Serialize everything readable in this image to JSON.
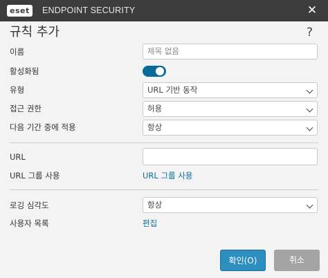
{
  "titlebar": {
    "logo_text": "eset",
    "app_title": "ENDPOINT SECURITY",
    "close_glyph": "✕"
  },
  "dialog": {
    "title": "규칙 추가",
    "help_glyph": "?"
  },
  "form": {
    "name": {
      "label": "이름",
      "placeholder": "제목 없음"
    },
    "enabled": {
      "label": "활성화됨",
      "value": true
    },
    "type": {
      "label": "유형",
      "value": "URL 기반 동작"
    },
    "access": {
      "label": "접근 권한",
      "value": "허용"
    },
    "apply_period": {
      "label": "다음 기간 중에 적용",
      "value": "항상"
    },
    "url": {
      "label": "URL",
      "value": ""
    },
    "url_group": {
      "label": "URL 그룹 사용",
      "link": "URL 그룹 사용"
    },
    "log_severity": {
      "label": "로깅 심각도",
      "value": "항상"
    },
    "user_list": {
      "label": "사용자 목록",
      "link": "편집"
    }
  },
  "buttons": {
    "ok": "확인(O)",
    "cancel": "취소"
  },
  "colors": {
    "titlebar": "#3c3c3c",
    "accent": "#0a6b99",
    "ok_button": "#2d8fbf",
    "cancel_button": "#a4a4a4"
  }
}
